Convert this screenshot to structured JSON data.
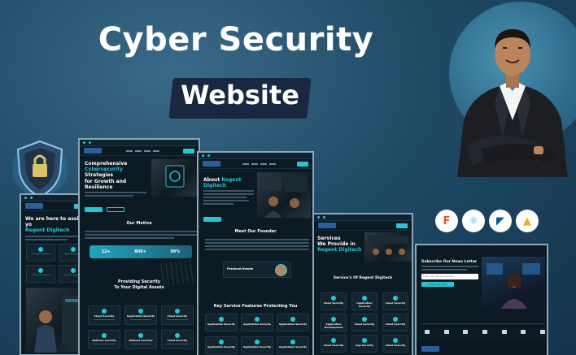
{
  "headline": {
    "line1": "Cyber Security",
    "line2": "Website"
  },
  "tech_icons": [
    {
      "name": "figma-icon",
      "glyph": "F",
      "color": "#f24e1e"
    },
    {
      "name": "react-icon",
      "glyph": "⚛",
      "color": "#61dafb"
    },
    {
      "name": "flutter-icon",
      "glyph": "◤",
      "color": "#02569b"
    },
    {
      "name": "firebase-icon",
      "glyph": "▲",
      "color": "#ffca28"
    }
  ],
  "mockups": {
    "left": {
      "hero_title_1": "We are here to assist yo",
      "hero_title_2": "Regent Digitech"
    },
    "second": {
      "hero_line1": "Comprehensive",
      "hero_accent": "Cybersecurity",
      "hero_line2": "Strategies",
      "hero_line3": "for Growth and Resilience",
      "motive_title": "Our Motive",
      "stat1_value": "12+",
      "stat2_value": "800+",
      "stat3_value": "99%",
      "section_title_1": "Providing Security",
      "section_title_2": "To Your Digital Assets",
      "cards": [
        "Cloud Security",
        "Application Security",
        "Cloud Security",
        "Network Security",
        "Network Security",
        "Cloud Security"
      ]
    },
    "third": {
      "about_prefix": "About",
      "about_name": "Regent Digitech",
      "founder_title": "Meet Our Founder",
      "founder_name": "Prashant Kewde",
      "features_title": "Key Service Features Protecting You",
      "feature_cards": [
        "Application Security",
        "Application Security",
        "Application Security",
        "Application Security",
        "Application Security",
        "Application Security"
      ]
    },
    "fourth": {
      "hero_line1": "Services",
      "hero_line2": "We Provide in",
      "hero_accent": "Regent Digitech",
      "services_title": "Service's Of Regent Digitech",
      "service_cards": [
        "Cloud Security",
        "Application Security",
        "Cloud Security",
        "Application Development",
        "Cloud Security",
        "Cloud Security",
        "Cloud Security",
        "App Security",
        "Cloud Security"
      ]
    },
    "fifth": {
      "newsletter_title": "Subscribe Our News Letter",
      "email_placeholder": "Enter Your Email Address",
      "subscribe_label": "Subscribe Now"
    }
  }
}
